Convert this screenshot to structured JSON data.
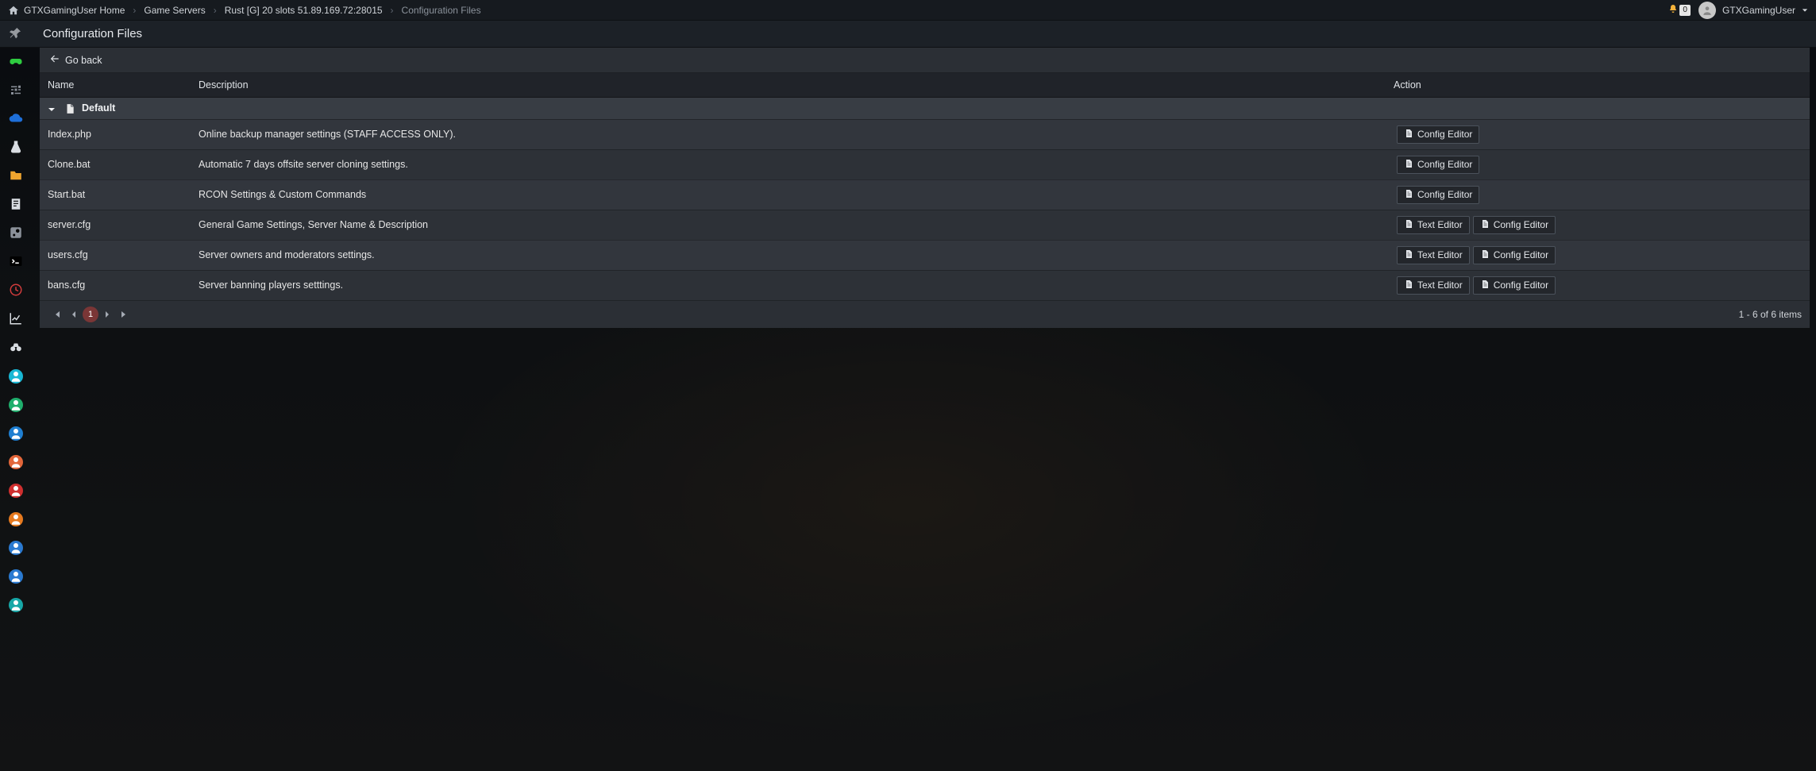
{
  "breadcrumb": {
    "home_label": "GTXGamingUser Home",
    "game_servers": "Game Servers",
    "server": "Rust [G] 20 slots 51.89.169.72:28015",
    "page": "Configuration Files"
  },
  "topbar": {
    "notif_count": "0",
    "username": "GTXGamingUser"
  },
  "title": "Configuration Files",
  "go_back_label": "Go back",
  "columns": {
    "name": "Name",
    "description": "Description",
    "action": "Action"
  },
  "group": "Default",
  "buttons": {
    "text_editor": "Text Editor",
    "config_editor": "Config Editor"
  },
  "files": [
    {
      "name": "Index.php",
      "desc": "Online backup manager settings (STAFF ACCESS ONLY).",
      "text_editor": false,
      "config_editor": true
    },
    {
      "name": "Clone.bat",
      "desc": "Automatic 7 days offsite server cloning settings.",
      "text_editor": false,
      "config_editor": true
    },
    {
      "name": "Start.bat",
      "desc": "RCON Settings & Custom Commands",
      "text_editor": false,
      "config_editor": true
    },
    {
      "name": "server.cfg",
      "desc": "General Game Settings, Server Name & Description",
      "text_editor": true,
      "config_editor": true
    },
    {
      "name": "users.cfg",
      "desc": "Server owners and moderators settings.",
      "text_editor": true,
      "config_editor": true
    },
    {
      "name": "bans.cfg",
      "desc": "Server banning players setttings.",
      "text_editor": true,
      "config_editor": true
    }
  ],
  "pager": {
    "current": "1",
    "summary": "1 - 6 of 6 items"
  },
  "sidebar": {
    "items": [
      {
        "id": "controller",
        "color": "#2ecc40"
      },
      {
        "id": "sliders",
        "color": "#8a9099"
      },
      {
        "id": "cloud",
        "color": "#1e6fd9"
      },
      {
        "id": "flask",
        "color": "#d9dde2"
      },
      {
        "id": "folder",
        "color": "#f0a52f"
      },
      {
        "id": "update",
        "color": "#d9dde2"
      },
      {
        "id": "steam",
        "color": "#8a9099"
      },
      {
        "id": "console",
        "color": "#ffffff"
      },
      {
        "id": "scheduler",
        "color": "#d23c3c"
      },
      {
        "id": "chart",
        "color": "#d9dde2"
      },
      {
        "id": "binoculars",
        "color": "#d9dde2"
      },
      {
        "id": "user-cyan",
        "dot": "#18b7d4"
      },
      {
        "id": "user-green",
        "dot": "#1fae6c"
      },
      {
        "id": "db-blue",
        "dot": "#1f7fd1"
      },
      {
        "id": "user-orange",
        "dot": "#e2663a"
      },
      {
        "id": "mod-red",
        "dot": "#cf2f2f"
      },
      {
        "id": "mod-orange",
        "dot": "#e67a1f"
      },
      {
        "id": "book-blue",
        "dot": "#2a7ad1"
      },
      {
        "id": "admin-blue",
        "dot": "#2a7ad1"
      },
      {
        "id": "wipe-teal",
        "dot": "#17a7a7"
      }
    ]
  }
}
